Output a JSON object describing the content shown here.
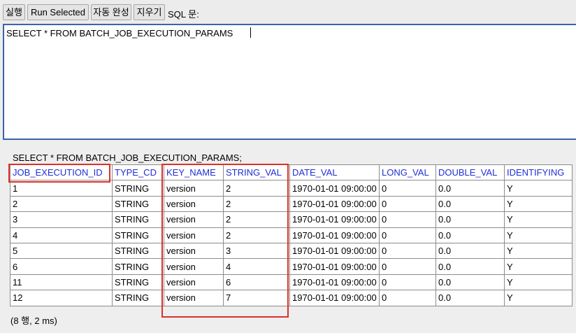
{
  "toolbar": {
    "run_label": "실행",
    "run_selected_label": "Run Selected",
    "autocomplete_label": "자동 완성",
    "clear_label": "지우기",
    "sql_label": "SQL 문:"
  },
  "editor": {
    "sql_text": "SELECT * FROM BATCH_JOB_EXECUTION_PARAMS"
  },
  "result": {
    "query": "SELECT * FROM BATCH_JOB_EXECUTION_PARAMS;",
    "columns": [
      "JOB_EXECUTION_ID",
      "TYPE_CD",
      "KEY_NAME",
      "STRING_VAL",
      "DATE_VAL",
      "LONG_VAL",
      "DOUBLE_VAL",
      "IDENTIFYING"
    ],
    "rows": [
      [
        "1",
        "STRING",
        "version",
        "2",
        "1970-01-01 09:00:00",
        "0",
        "0.0",
        "Y"
      ],
      [
        "2",
        "STRING",
        "version",
        "2",
        "1970-01-01 09:00:00",
        "0",
        "0.0",
        "Y"
      ],
      [
        "3",
        "STRING",
        "version",
        "2",
        "1970-01-01 09:00:00",
        "0",
        "0.0",
        "Y"
      ],
      [
        "4",
        "STRING",
        "version",
        "2",
        "1970-01-01 09:00:00",
        "0",
        "0.0",
        "Y"
      ],
      [
        "5",
        "STRING",
        "version",
        "3",
        "1970-01-01 09:00:00",
        "0",
        "0.0",
        "Y"
      ],
      [
        "6",
        "STRING",
        "version",
        "4",
        "1970-01-01 09:00:00",
        "0",
        "0.0",
        "Y"
      ],
      [
        "11",
        "STRING",
        "version",
        "6",
        "1970-01-01 09:00:00",
        "0",
        "0.0",
        "Y"
      ],
      [
        "12",
        "STRING",
        "version",
        "7",
        "1970-01-01 09:00:00",
        "0",
        "0.0",
        "Y"
      ]
    ],
    "summary": "(8 행, 2 ms)"
  },
  "colors": {
    "header_text": "#1f2fd6",
    "editor_border": "#3a64a8",
    "highlight_box": "#d9322a"
  }
}
